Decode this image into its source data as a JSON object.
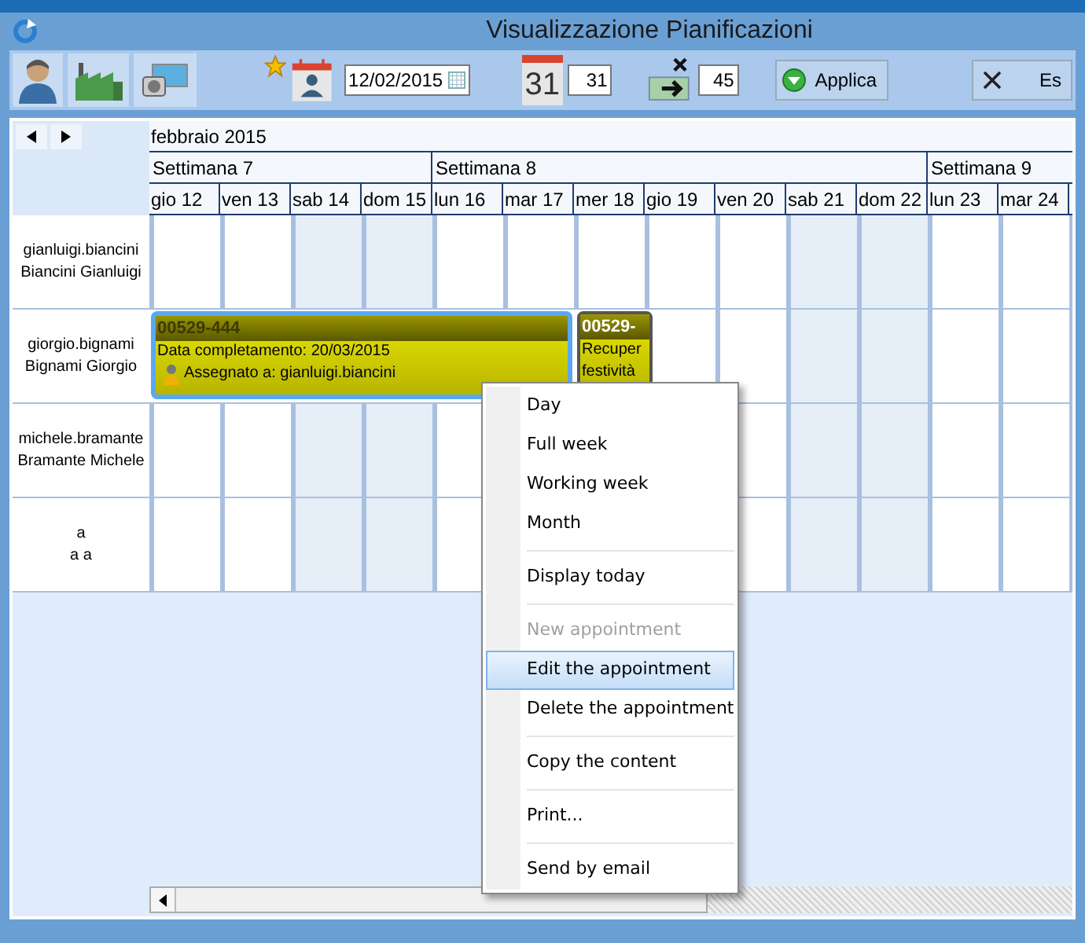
{
  "window": {
    "title": "Visualizzazione Pianificazioni"
  },
  "toolbar": {
    "date_field": {
      "value": "12/02/2015"
    },
    "calendar_icon_text": "31",
    "days_field": {
      "value": "31"
    },
    "shift_field": {
      "value": "45"
    },
    "apply_button": "Applica",
    "exit_button": "Es"
  },
  "calendar": {
    "month": "febbraio 2015",
    "weeks": [
      {
        "label": "Settimana 7"
      },
      {
        "label": "Settimana 8"
      },
      {
        "label": "Settimana 9"
      }
    ],
    "days": [
      {
        "label": "gio 12",
        "weekend": false
      },
      {
        "label": "ven 13",
        "weekend": false
      },
      {
        "label": "sab 14",
        "weekend": true
      },
      {
        "label": "dom 15",
        "weekend": true
      },
      {
        "label": "lun 16",
        "weekend": false
      },
      {
        "label": "mar 17",
        "weekend": false
      },
      {
        "label": "mer 18",
        "weekend": false
      },
      {
        "label": "gio 19",
        "weekend": false
      },
      {
        "label": "ven 20",
        "weekend": false
      },
      {
        "label": "sab 21",
        "weekend": true
      },
      {
        "label": "dom 22",
        "weekend": true
      },
      {
        "label": "lun 23",
        "weekend": false
      },
      {
        "label": "mar 24",
        "weekend": false
      }
    ],
    "resources": [
      {
        "user": "gianluigi.biancini",
        "name": "Biancini Gianluigi"
      },
      {
        "user": "giorgio.bignami",
        "name": "Bignami Giorgio",
        "appointments": [
          {
            "title": "00529-444",
            "lines": [
              "Data completamento: 20/03/2015",
              "Assegnato a: gianluigi.biancini"
            ],
            "selected": true
          },
          {
            "title": "00529-",
            "lines": [
              "Recuper",
              "festività"
            ],
            "selected": false
          }
        ]
      },
      {
        "user": "michele.bramante",
        "name": "Bramante Michele"
      },
      {
        "user": "a",
        "name": "a a"
      }
    ]
  },
  "context_menu": {
    "groups": [
      [
        {
          "label": "Day",
          "disabled": false,
          "selected": false
        },
        {
          "label": "Full week",
          "disabled": false,
          "selected": false
        },
        {
          "label": "Working week",
          "disabled": false,
          "selected": false
        },
        {
          "label": "Month",
          "disabled": false,
          "selected": false
        }
      ],
      [
        {
          "label": "Display today",
          "disabled": false,
          "selected": false
        }
      ],
      [
        {
          "label": "New appointment",
          "disabled": true,
          "selected": false
        },
        {
          "label": "Edit the appointment",
          "disabled": false,
          "selected": true
        },
        {
          "label": "Delete the appointment",
          "disabled": false,
          "selected": false
        }
      ],
      [
        {
          "label": "Copy the content",
          "disabled": false,
          "selected": false
        }
      ],
      [
        {
          "label": "Print...",
          "disabled": false,
          "selected": false
        }
      ],
      [
        {
          "label": "Send by email",
          "disabled": false,
          "selected": false
        }
      ]
    ]
  }
}
